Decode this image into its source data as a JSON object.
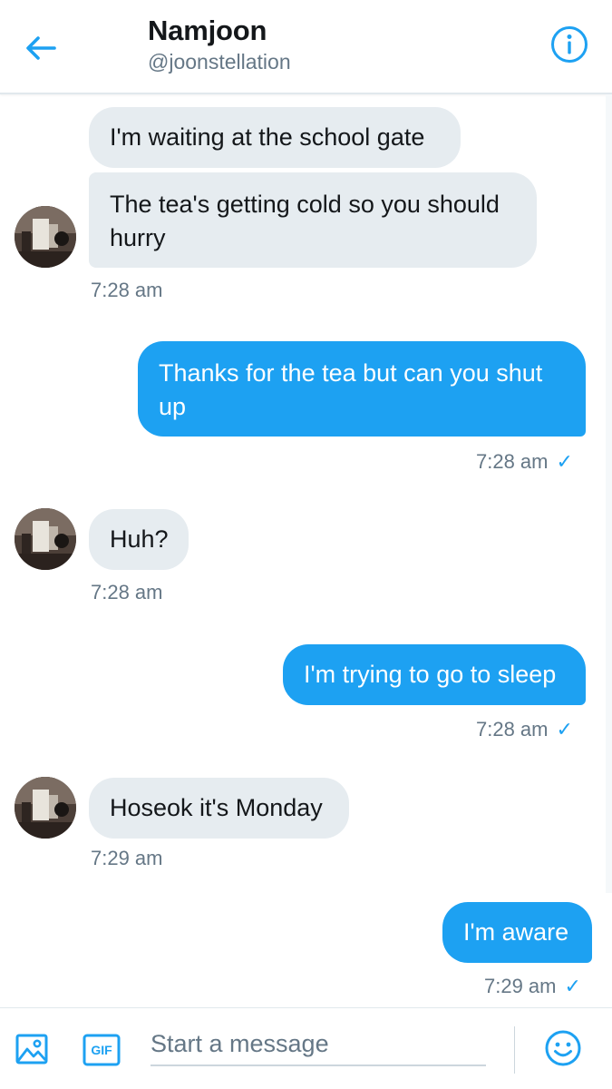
{
  "header": {
    "title": "Namjoon",
    "handle": "@joonstellation"
  },
  "messages": [
    {
      "text": "I'm waiting at the school gate"
    },
    {
      "text": "The tea's getting cold so you should hurry",
      "time": "7:28 am"
    },
    {
      "text": "Thanks for the tea but can you shut up",
      "time": "7:28 am"
    },
    {
      "text": "Huh?",
      "time": "7:28 am"
    },
    {
      "text": "I'm trying to go to sleep",
      "time": "7:28 am"
    },
    {
      "text": "Hoseok it's Monday",
      "time": "7:29 am"
    },
    {
      "text": "I'm aware",
      "time": "7:29 am"
    }
  ],
  "read_mark": "✓",
  "composer": {
    "placeholder": "Start a message",
    "gif_label": "GIF"
  },
  "colors": {
    "accent": "#1da1f2",
    "incoming_bubble": "#e6ecf0",
    "secondary_text": "#657786"
  },
  "icons": [
    "back-arrow-icon",
    "info-icon",
    "image-icon",
    "gif-icon",
    "emoji-icon"
  ]
}
